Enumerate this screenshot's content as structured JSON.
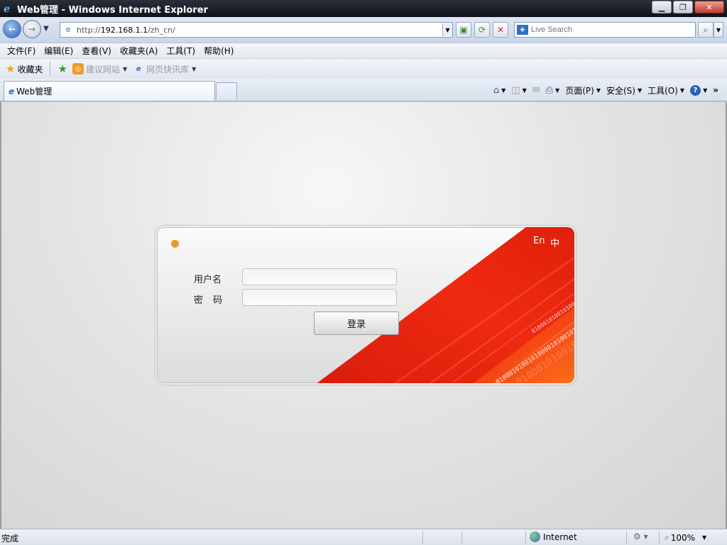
{
  "window": {
    "title": "Web管理 - Windows Internet Explorer",
    "controls": {
      "minimize": "▁",
      "maximize": "❐",
      "close": "✕"
    }
  },
  "address": {
    "url_prefix": "http://",
    "url_host": "192.168.1.1",
    "url_path": "/zh_cn/",
    "search_placeholder": "Live Search"
  },
  "menubar": {
    "items": [
      "文件(F)",
      "编辑(E)",
      "查看(V)",
      "收藏夹(A)",
      "工具(T)",
      "帮助(H)"
    ]
  },
  "favorites": {
    "label": "收藏夹",
    "links": [
      "建议网站",
      "网页快讯库"
    ]
  },
  "tab": {
    "label": "Web管理"
  },
  "commandbar": {
    "page": "页面(P)",
    "safety": "安全(S)",
    "tools": "工具(O)",
    "help": "?",
    "more": "»"
  },
  "login": {
    "lang_en": "En",
    "lang_zh": "中",
    "username_label": "用户名",
    "password_label": "密码",
    "username_value": "",
    "password_value": "",
    "submit": "登录",
    "binary_text": "01000101001010000101001010101"
  },
  "statusbar": {
    "status": "完成",
    "zone": "Internet",
    "zoom": "100%"
  },
  "colors": {
    "accent_red": "#e8200e",
    "dot_orange": "#e79b2c"
  }
}
